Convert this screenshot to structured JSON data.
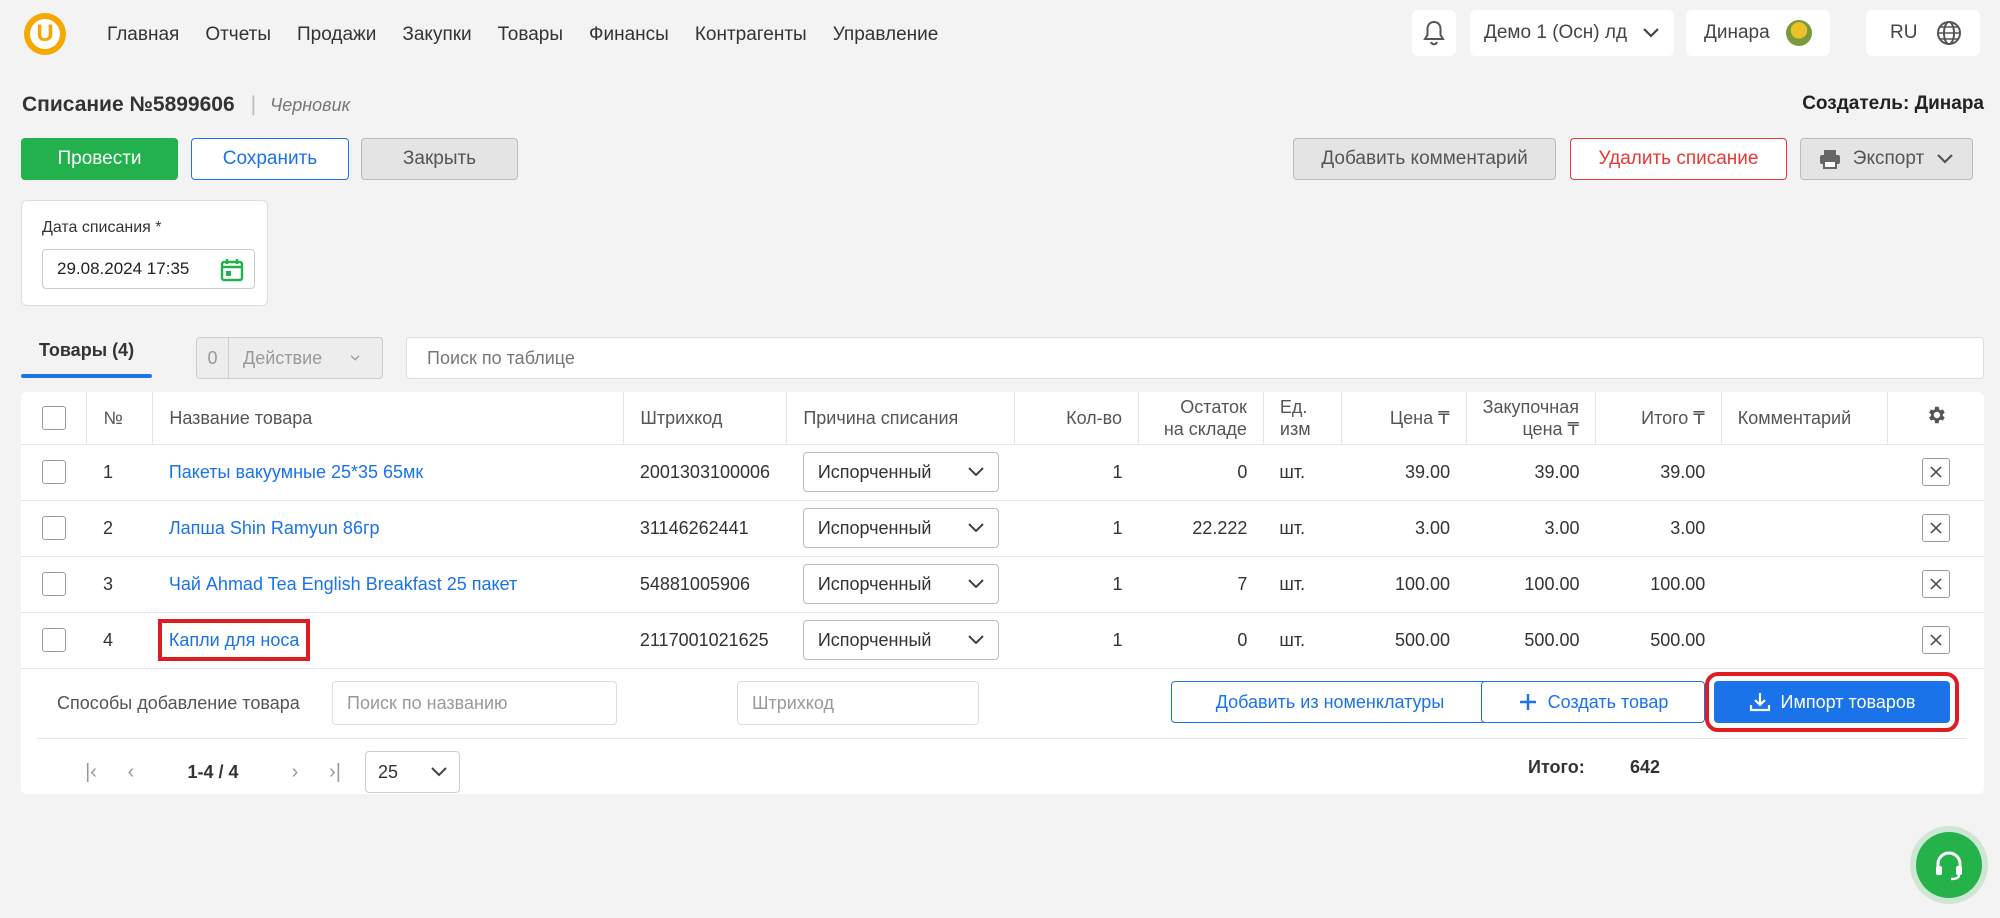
{
  "nav": {
    "logo": "U",
    "items": [
      "Главная",
      "Отчеты",
      "Продажи",
      "Закупки",
      "Товары",
      "Финансы",
      "Контрагенты",
      "Управление"
    ]
  },
  "topbar": {
    "org": "Демо 1 (Осн) лд",
    "user": "Динара",
    "lang": "RU"
  },
  "doc": {
    "title": "Списание №5899606",
    "status": "Черновик",
    "creator": "Создатель: Динара"
  },
  "actions": {
    "post": "Провести",
    "save": "Сохранить",
    "close": "Закрыть",
    "comment": "Добавить комментарий",
    "delete": "Удалить списание",
    "export": "Экспорт"
  },
  "date": {
    "label": "Дата списания *",
    "value": "29.08.2024 17:35"
  },
  "tabs": {
    "goods": "Товары  (4)",
    "selected_count": "0",
    "action": "Действие",
    "search_placeholder": "Поиск по таблице"
  },
  "table": {
    "headers": {
      "num": "№",
      "name": "Название товара",
      "barcode": "Штрихкод",
      "reason": "Причина списания",
      "qty": "Кол-во",
      "stock_1": "Остаток",
      "stock_2": "на складе",
      "unit_1": "Ед.",
      "unit_2": "изм",
      "price": "Цена ₸",
      "purchase_1": "Закупочная",
      "purchase_2": "цена ₸",
      "total": "Итого ₸",
      "comment": "Комментарий"
    },
    "rows": [
      {
        "num": "1",
        "name": "Пакеты вакуумные 25*35 65мк",
        "barcode": "2001303100006",
        "reason": "Испорченный",
        "qty": "1",
        "stock": "0",
        "unit": "шт.",
        "price": "39.00",
        "purchase": "39.00",
        "total": "39.00"
      },
      {
        "num": "2",
        "name": "Лапша Shin Ramyun 86гр",
        "barcode": "31146262441",
        "reason": "Испорченный",
        "qty": "1",
        "stock": "22.222",
        "unit": "шт.",
        "price": "3.00",
        "purchase": "3.00",
        "total": "3.00"
      },
      {
        "num": "3",
        "name": "Чай Ahmad Tea English Breakfast 25 пакет",
        "barcode": "54881005906",
        "reason": "Испорченный",
        "qty": "1",
        "stock": "7",
        "unit": "шт.",
        "price": "100.00",
        "purchase": "100.00",
        "total": "100.00"
      },
      {
        "num": "4",
        "name": "Капли для носа",
        "barcode": "2117001021625",
        "reason": "Испорченный",
        "qty": "1",
        "stock": "0",
        "unit": "шт.",
        "price": "500.00",
        "purchase": "500.00",
        "total": "500.00"
      }
    ]
  },
  "add": {
    "label": "Способы добавление товара",
    "name_placeholder": "Поиск по названию",
    "barcode_placeholder": "Штрихкод",
    "from_nomenclature": "Добавить из номенклатуры",
    "create": "Создать товар",
    "import": "Импорт товаров"
  },
  "pager": {
    "range": "1-4 / 4",
    "per_page": "25",
    "total_label": "Итого:",
    "total_value": "642"
  }
}
